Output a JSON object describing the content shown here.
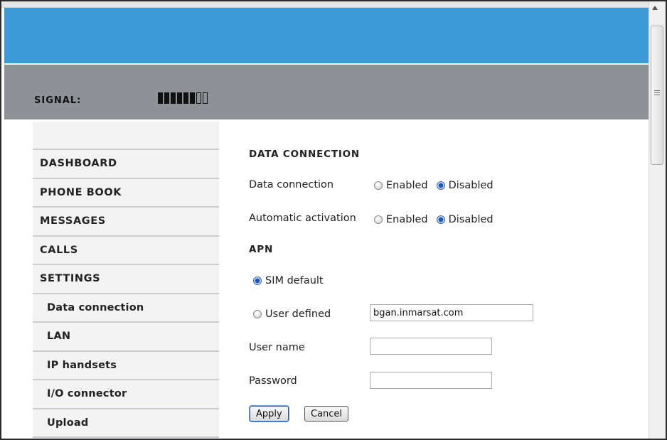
{
  "signal": {
    "label": "SIGNAL:",
    "bars_total": 8,
    "bars_filled": 6
  },
  "sidebar": {
    "items": [
      {
        "label": "DASHBOARD"
      },
      {
        "label": "PHONE BOOK"
      },
      {
        "label": "MESSAGES"
      },
      {
        "label": "CALLS"
      },
      {
        "label": "SETTINGS"
      },
      {
        "label": "Data connection"
      },
      {
        "label": "LAN"
      },
      {
        "label": "IP handsets"
      },
      {
        "label": "I/O connector"
      },
      {
        "label": "Upload"
      }
    ]
  },
  "form": {
    "data_connection_title": "DATA CONNECTION",
    "data_connection": {
      "label": "Data connection",
      "options": [
        "Enabled",
        "Disabled"
      ],
      "selected": "Disabled"
    },
    "automatic_activation": {
      "label": "Automatic activation",
      "options": [
        "Enabled",
        "Disabled"
      ],
      "selected": "Disabled"
    },
    "apn_title": "APN",
    "apn_options": {
      "sim_default": "SIM default",
      "user_defined": "User defined",
      "selected": "SIM default"
    },
    "apn_value": "bgan.inmarsat.com",
    "user_name": {
      "label": "User name",
      "value": ""
    },
    "password": {
      "label": "Password",
      "value": ""
    },
    "buttons": {
      "apply": "Apply",
      "cancel": "Cancel"
    }
  },
  "colors": {
    "banner": "#3b9ad8",
    "signal_bar": "#8e9195",
    "sidebar_bg": "#f3f3f3",
    "radio_selected": "#1f58b8"
  }
}
